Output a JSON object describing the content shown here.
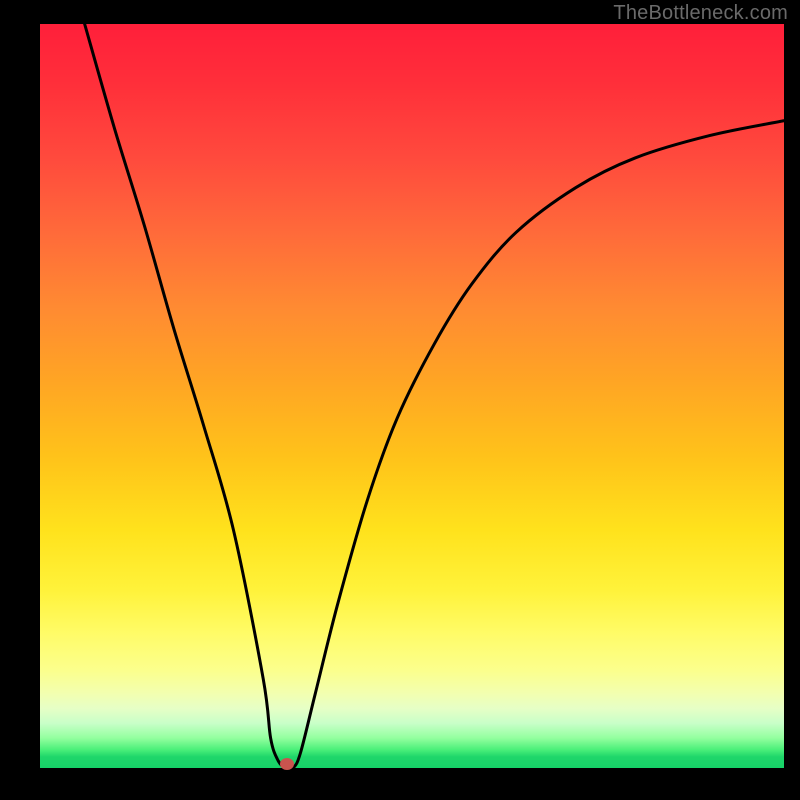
{
  "watermark": "TheBottleneck.com",
  "chart_data": {
    "type": "line",
    "title": "",
    "xlabel": "",
    "ylabel": "",
    "xlim": [
      0,
      100
    ],
    "ylim": [
      0,
      100
    ],
    "grid": false,
    "legend": false,
    "annotations": [],
    "series": [
      {
        "name": "bottleneck-curve",
        "x": [
          6,
          10,
          14,
          18,
          22,
          26,
          30,
          31,
          32,
          33,
          34,
          35,
          37,
          40,
          44,
          48,
          53,
          58,
          64,
          72,
          80,
          90,
          100
        ],
        "values": [
          100,
          86,
          73,
          59,
          46,
          32,
          12,
          4,
          1,
          0,
          0,
          2,
          10,
          22,
          36,
          47,
          57,
          65,
          72,
          78,
          82,
          85,
          87
        ]
      }
    ],
    "marker": {
      "x": 33.2,
      "y": 0.5,
      "name": "bottleneck-point"
    },
    "colors": {
      "curve": "#000000",
      "marker": "#c9544e",
      "gradient_top": "#ff1f3a",
      "gradient_bottom": "#16d268"
    }
  }
}
